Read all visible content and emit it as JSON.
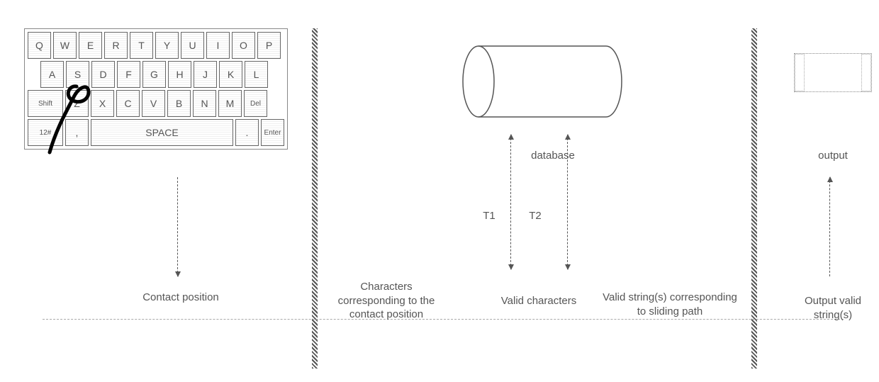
{
  "keyboard": {
    "row1": [
      "Q",
      "W",
      "E",
      "R",
      "T",
      "Y",
      "U",
      "I",
      "O",
      "P"
    ],
    "row2": [
      "A",
      "S",
      "D",
      "F",
      "G",
      "H",
      "J",
      "K",
      "L"
    ],
    "row3_shift": "Shift",
    "row3": [
      "Z",
      "X",
      "C",
      "V",
      "B",
      "N",
      "M"
    ],
    "row3_del": "Del",
    "row4_sym": "12#",
    "row4_comma": ",",
    "row4_space": "SPACE",
    "row4_dot": ".",
    "row4_enter": "Enter"
  },
  "labels": {
    "contact_position": "Contact position",
    "chars_corresponding": "Characters corresponding to the contact position",
    "database": "database",
    "t1": "T1",
    "t2": "T2",
    "valid_characters": "Valid characters",
    "valid_strings": "Valid string(s) corresponding to sliding path",
    "output": "output",
    "output_valid": "Output valid string(s)"
  }
}
